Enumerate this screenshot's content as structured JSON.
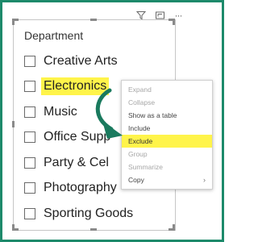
{
  "slicer": {
    "title": "Department",
    "items": [
      {
        "label": "Creative Arts",
        "highlighted": false
      },
      {
        "label": "Electronics",
        "highlighted": true
      },
      {
        "label": "Music",
        "highlighted": false
      },
      {
        "label": "Office Supp",
        "highlighted": false
      },
      {
        "label": "Party & Cel",
        "highlighted": false
      },
      {
        "label": "Photography",
        "highlighted": false
      },
      {
        "label": "Sporting Goods",
        "highlighted": false
      }
    ]
  },
  "toolbar": {
    "icons": [
      "filter-icon",
      "focus-mode-icon",
      "more-options-icon"
    ],
    "more_glyph": "···"
  },
  "context_menu": {
    "items": [
      {
        "label": "Expand",
        "enabled": false,
        "highlighted": false
      },
      {
        "label": "Collapse",
        "enabled": false,
        "highlighted": false
      },
      {
        "label": "Show as a table",
        "enabled": true,
        "highlighted": false
      },
      {
        "label": "Include",
        "enabled": true,
        "highlighted": false
      },
      {
        "label": "Exclude",
        "enabled": true,
        "highlighted": true
      },
      {
        "label": "Group",
        "enabled": false,
        "highlighted": false
      },
      {
        "label": "Summarize",
        "enabled": false,
        "highlighted": false
      },
      {
        "label": "Copy",
        "enabled": true,
        "highlighted": false,
        "has_submenu": true
      }
    ],
    "submenu_glyph": "›"
  },
  "colors": {
    "frame_border": "#1d8a6b",
    "highlight": "#fff44a",
    "arrow": "#1a7a5e"
  }
}
